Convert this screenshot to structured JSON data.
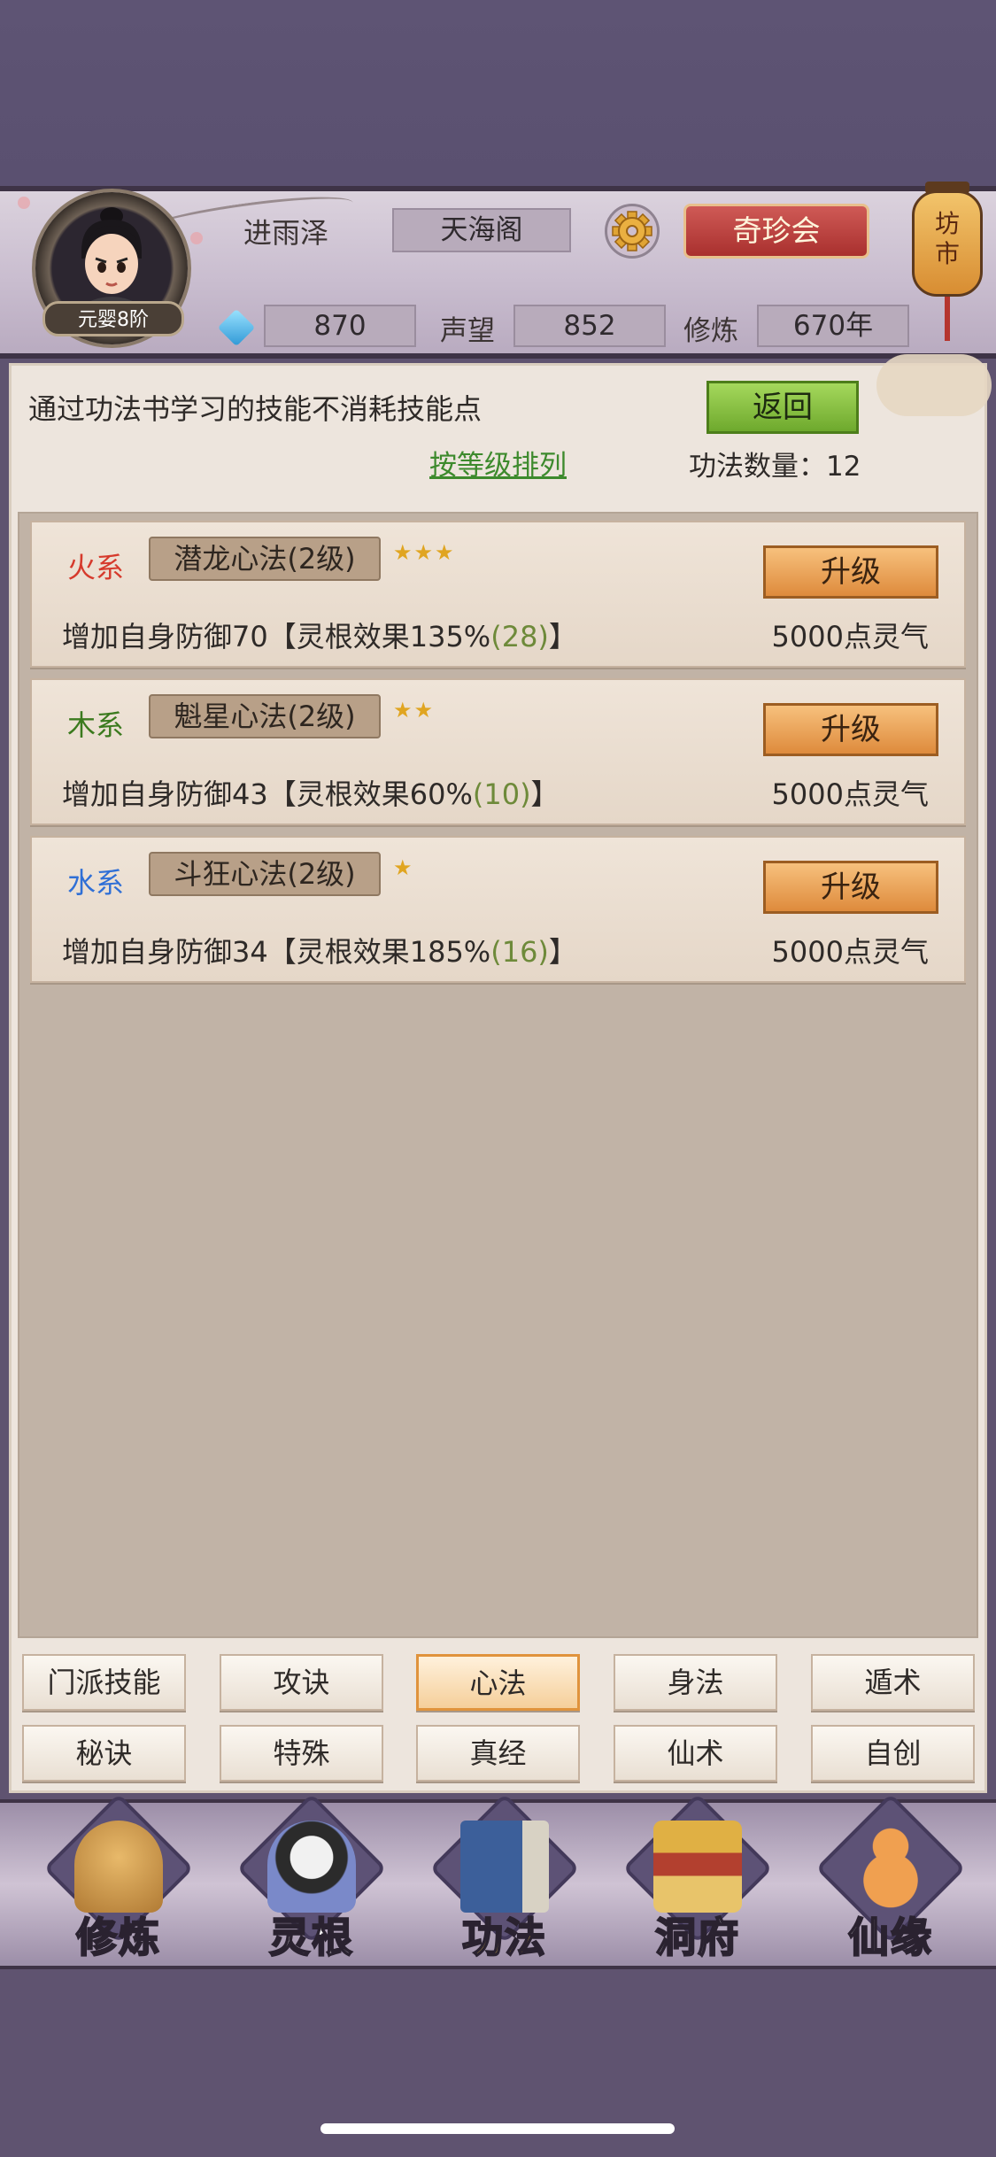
{
  "header": {
    "player_name": "进雨泽",
    "rank": "元婴8阶",
    "sect": "天海阁",
    "treasure_button": "奇珍会",
    "market_sign": "坊市",
    "gems": "870",
    "reputation_label": "声望",
    "reputation": "852",
    "cultivation_label": "修炼",
    "cultivation": "670年"
  },
  "panel": {
    "notice": "通过功法书学习的技能不消耗技能点",
    "return_label": "返回",
    "sort_label": "按等级排列",
    "count_text": "功法数量：12"
  },
  "skills": [
    {
      "element": "火系",
      "element_color": "#d63a2c",
      "name": "潜龙心法(2级)",
      "stars": "★★★",
      "star_count": 3,
      "upgrade": "升级",
      "desc_prefix": "增加自身防御70【灵根效果135%",
      "desc_bonus": "(28)",
      "desc_suffix": "】",
      "cost": "5000点灵气"
    },
    {
      "element": "木系",
      "element_color": "#3b7a1e",
      "name": "魁星心法(2级)",
      "stars": "★★",
      "star_count": 2,
      "upgrade": "升级",
      "desc_prefix": "增加自身防御43【灵根效果60%",
      "desc_bonus": "(10)",
      "desc_suffix": "】",
      "cost": "5000点灵气"
    },
    {
      "element": "水系",
      "element_color": "#2f6fd6",
      "name": "斗狂心法(2级)",
      "stars": "★",
      "star_count": 1,
      "upgrade": "升级",
      "desc_prefix": "增加自身防御34【灵根效果185%",
      "desc_bonus": "(16)",
      "desc_suffix": "】",
      "cost": "5000点灵气"
    }
  ],
  "tabs": [
    "门派技能",
    "攻诀",
    "心法",
    "身法",
    "遁术",
    "秘诀",
    "特殊",
    "真经",
    "仙术",
    "自创"
  ],
  "active_tab": "心法",
  "nav": [
    {
      "label": "修炼",
      "icon": "cultivate-icon",
      "color": "#c99345"
    },
    {
      "label": "灵根",
      "icon": "spirit-root-icon",
      "color": "#5d6ea8"
    },
    {
      "label": "功法",
      "icon": "technique-book-icon",
      "color": "#3c5f9a"
    },
    {
      "label": "洞府",
      "icon": "cave-dwelling-icon",
      "color": "#c98f2c"
    },
    {
      "label": "仙缘",
      "icon": "gourd-icon",
      "color": "#d8823a"
    }
  ],
  "active_nav": "功法"
}
